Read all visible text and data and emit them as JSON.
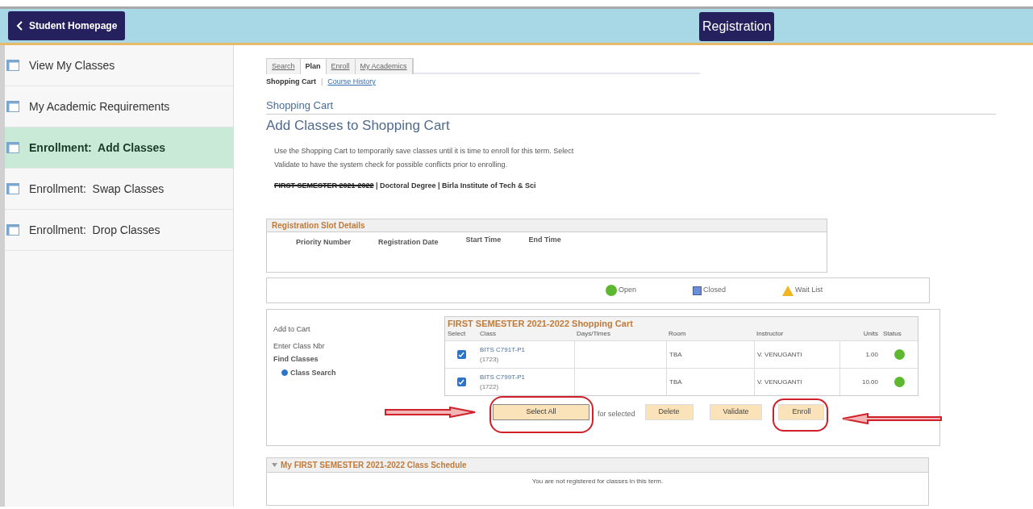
{
  "header": {
    "back_button": "Student Homepage",
    "title": "Registration"
  },
  "sidebar": {
    "items": [
      {
        "label": "View My Classes",
        "selected": false
      },
      {
        "label": "My Academic Requirements",
        "selected": false
      },
      {
        "label": "Enrollment:  Add Classes",
        "selected": true
      },
      {
        "label": "Enrollment:  Swap Classes",
        "selected": false
      },
      {
        "label": "Enrollment:  Drop Classes",
        "selected": false
      }
    ]
  },
  "tabs": [
    {
      "label": "Search",
      "selected": false
    },
    {
      "label": "Plan",
      "selected": true
    },
    {
      "label": "Enroll",
      "selected": false
    },
    {
      "label": "My Academics",
      "selected": false
    }
  ],
  "subnav": [
    {
      "label": "Shopping Cart",
      "selected": true
    },
    {
      "label": "Course History",
      "selected": false
    }
  ],
  "subnav_separator": "|",
  "breadcrumb": "Shopping Cart",
  "page_title": "Add Classes to Shopping Cart",
  "instructions": [
    "Use the Shopping Cart to temporarily save classes until it is time to enroll for this term.  Select",
    "Validate to have the system check for possible conflicts prior to enrolling."
  ],
  "term": {
    "redacted": "FIRST SEMESTER 2021-2022",
    "rest": " | Doctoral Degree | Birla Institute of Tech & Sci"
  },
  "slot_details": {
    "title": "Registration Slot Details",
    "columns": [
      "Priority Number",
      "Registration Date",
      "Start Time",
      "End Time"
    ]
  },
  "legend": [
    {
      "kind": "open",
      "label": "Open"
    },
    {
      "kind": "closed",
      "label": "Closed"
    },
    {
      "kind": "waitlist",
      "label": "Wait List"
    }
  ],
  "add_to_cart": {
    "title": "Add to Cart",
    "enter": "Enter Class Nbr",
    "find": "Find Classes",
    "options": [
      {
        "label": "Class Search",
        "selected": true
      }
    ]
  },
  "cart": {
    "title": "FIRST SEMESTER 2021-2022 Shopping Cart",
    "columns": [
      "Select",
      "Class",
      "Days/Times",
      "Room",
      "Instructor",
      "Units",
      "Status"
    ],
    "rows": [
      {
        "checked": true,
        "class": "BITS C791T-P1",
        "number": "(1723)",
        "room": "TBA",
        "instructor": "V. VENUGANTI",
        "units": "1.00",
        "color": "#5cb82e"
      },
      {
        "checked": true,
        "class": "BITS C799T-P1",
        "number": "(1722)",
        "room": "TBA",
        "instructor": "V. VENUGANTI",
        "units": "10.00",
        "color": "#5cb82e"
      }
    ]
  },
  "actions": {
    "select_all": "Select All",
    "for_selected": "for selected",
    "buttons": [
      "Delete",
      "Validate",
      "Enroll"
    ]
  },
  "schedule": {
    "title": "My FIRST SEMESTER 2021-2022 Class Schedule",
    "message": "You are not registered for classes in this term."
  }
}
